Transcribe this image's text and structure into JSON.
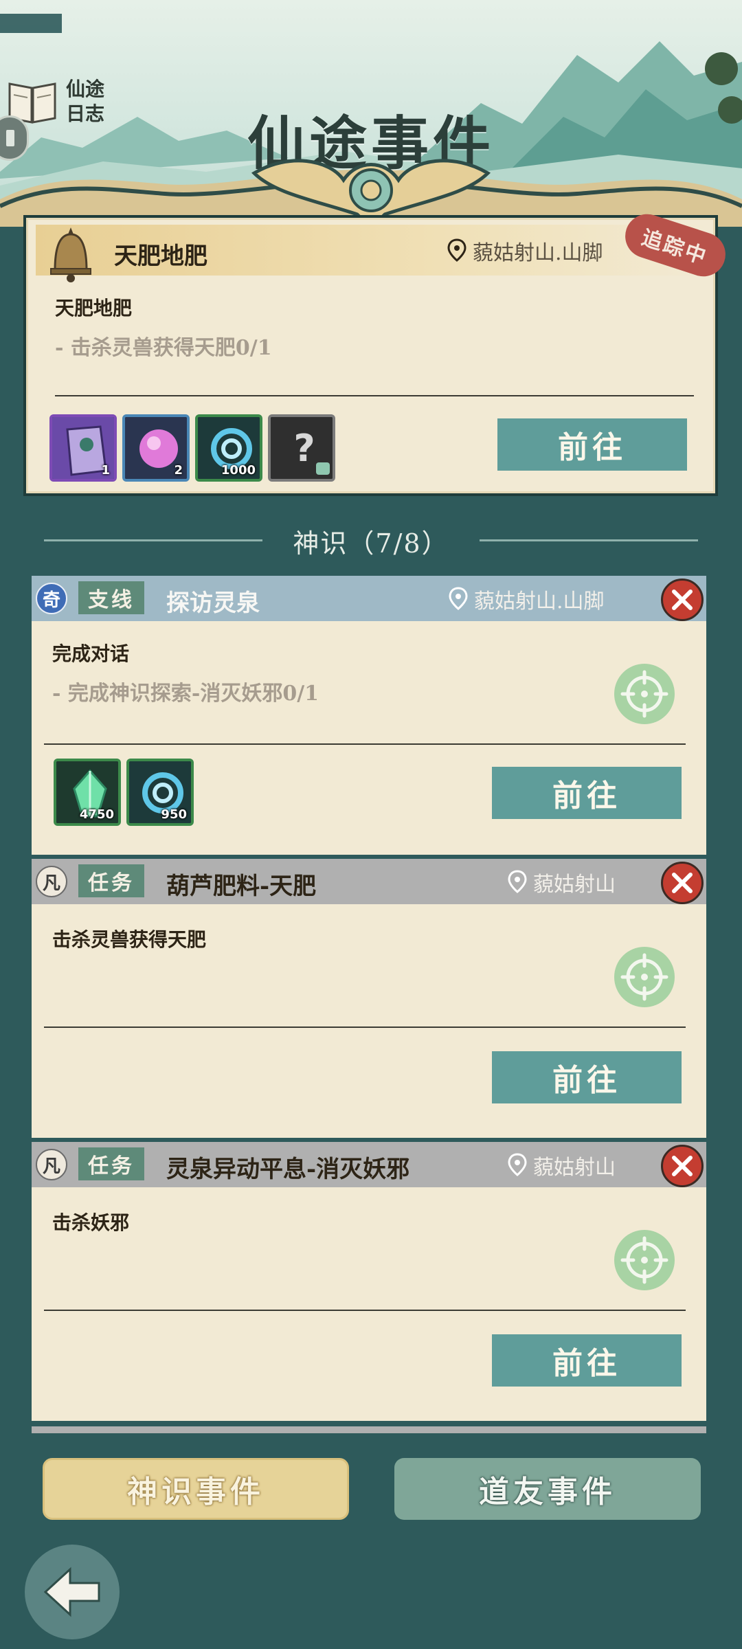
{
  "header": {
    "journal_label_line1": "仙途",
    "journal_label_line2": "日志",
    "page_title": "仙途事件"
  },
  "tracked_event": {
    "title": "天肥地肥",
    "location": "藐姑射山.山脚",
    "badge": "追踪中",
    "objective_name": "天肥地肥",
    "objective_line": "- 击杀灵兽获得天肥0/1",
    "rewards": [
      {
        "icon": "purple-book-icon",
        "count": "1"
      },
      {
        "icon": "pink-orb-icon",
        "count": "2"
      },
      {
        "icon": "blue-swirl-icon",
        "count": "1000"
      },
      {
        "icon": "mystery-question-icon",
        "count": ""
      }
    ],
    "go_label": "前往"
  },
  "section": {
    "label": "神识（7/8）"
  },
  "quests": [
    {
      "rarity": "奇",
      "tag": "支线",
      "title": "探访灵泉",
      "location": "藐姑射山.山脚",
      "objective_name": "完成对话",
      "objective_line": "- 完成神识探索-消灭妖邪0/1",
      "rewards": [
        {
          "icon": "green-crystal-icon",
          "count": "4750"
        },
        {
          "icon": "blue-swirl-icon",
          "count": "950"
        }
      ],
      "go_label": "前往"
    },
    {
      "rarity": "凡",
      "tag": "任务",
      "title": "葫芦肥料-天肥",
      "location": "藐姑射山",
      "objective_name": "击杀灵兽获得天肥",
      "go_label": "前往"
    },
    {
      "rarity": "凡",
      "tag": "任务",
      "title": "灵泉异动平息-消灭妖邪",
      "location": "藐姑射山",
      "objective_name": "击杀妖邪",
      "go_label": "前往"
    }
  ],
  "tabs": {
    "active": "神识事件",
    "inactive": "道友事件"
  },
  "colors": {
    "background": "#2e5a5b",
    "card": "#f2ead4",
    "go_button": "#5f9d9a",
    "close_button": "#c43d31",
    "tracking_badge": "#b8524a"
  }
}
